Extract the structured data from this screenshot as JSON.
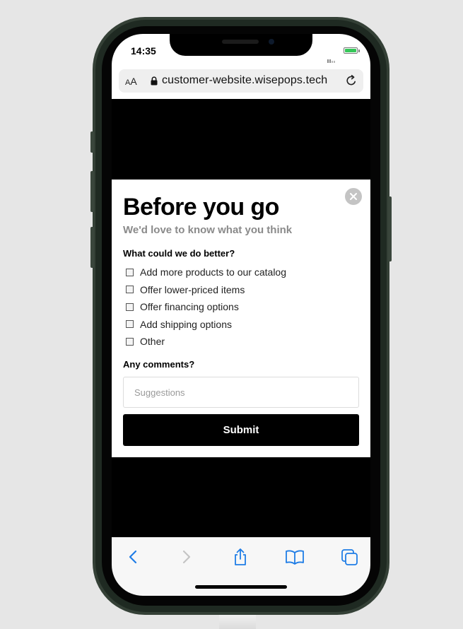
{
  "status_bar": {
    "time": "14:35"
  },
  "browser": {
    "text_size_label": "AA",
    "url": "customer-website.wisepops.tech",
    "icons": {
      "lock": "lock-icon",
      "reload": "reload-icon"
    }
  },
  "popup": {
    "title": "Before you go",
    "subtitle": "We'd love to know what you think",
    "question": "What could we do better?",
    "options": [
      {
        "label": "Add more products to our catalog",
        "checked": false
      },
      {
        "label": "Offer lower-priced items",
        "checked": false
      },
      {
        "label": "Offer financing options",
        "checked": false
      },
      {
        "label": "Add shipping options",
        "checked": false
      },
      {
        "label": "Other",
        "checked": false
      }
    ],
    "comments_label": "Any comments?",
    "comments_placeholder": "Suggestions",
    "comments_value": "",
    "submit_label": "Submit",
    "colors": {
      "primary": "#000000",
      "subtitle": "#8a8a8a",
      "close_button": "#c4c4c4"
    }
  },
  "toolbar": {
    "items": [
      {
        "name": "back",
        "icon": "chevron-left-icon",
        "enabled": true
      },
      {
        "name": "forward",
        "icon": "chevron-right-icon",
        "enabled": false
      },
      {
        "name": "share",
        "icon": "share-icon",
        "enabled": true
      },
      {
        "name": "bookmarks",
        "icon": "book-icon",
        "enabled": true
      },
      {
        "name": "tabs",
        "icon": "tabs-icon",
        "enabled": true
      }
    ],
    "accent_color": "#1f7de6"
  }
}
